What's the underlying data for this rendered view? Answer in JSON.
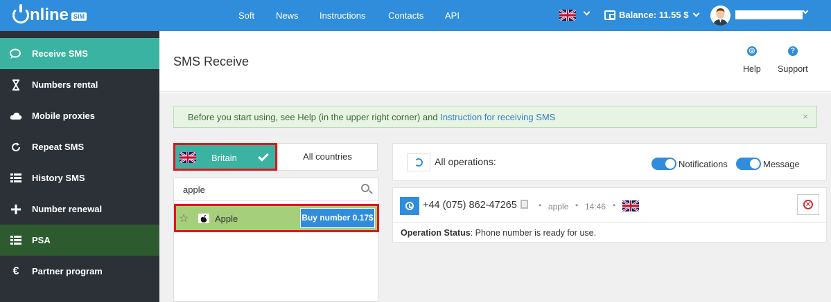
{
  "topbar": {
    "logo_text": "nline",
    "logo_badge": "SIM",
    "nav": [
      {
        "label": "Soft"
      },
      {
        "label": "News"
      },
      {
        "label": "Instructions"
      },
      {
        "label": "Contacts"
      },
      {
        "label": "API"
      }
    ],
    "balance": "Balance: 11.55 $"
  },
  "sidebar": {
    "items": [
      {
        "label": "Receive SMS",
        "icon": "chat-icon"
      },
      {
        "label": "Numbers rental",
        "icon": "hourglass-icon"
      },
      {
        "label": "Mobile proxies",
        "icon": "cloud-icon"
      },
      {
        "label": "Repeat SMS",
        "icon": "repeat-icon"
      },
      {
        "label": "History SMS",
        "icon": "list-icon"
      },
      {
        "label": "Number renewal",
        "icon": "plus-icon"
      },
      {
        "label": "PSA",
        "icon": "list-icon"
      },
      {
        "label": "Partner program",
        "icon": "euro-icon"
      }
    ]
  },
  "header": {
    "title": "SMS Receive",
    "help_label": "Help",
    "support_label": "Support"
  },
  "alert": {
    "text": "Before you start using, see Help (in the upper right corner) and ",
    "link": "Instruction for receiving SMS",
    "close": "×"
  },
  "countries": {
    "selected": "Britain",
    "all": "All countries"
  },
  "search": {
    "value": "apple"
  },
  "service": {
    "name": "Apple",
    "buy_label": "Buy number 0.17$"
  },
  "operations": {
    "label": "All operations:",
    "notifications_label": "Notifications",
    "message_label": "Message",
    "items": [
      {
        "phone": "+44 (075) 862-47265",
        "service": "apple",
        "time": "14:46",
        "status_label": "Operation Status",
        "status_text": ": Phone number is ready for use."
      }
    ]
  },
  "colors": {
    "topbar": "#2f8ddc",
    "sidebar": "#2b3137",
    "sidebar_active": "#3bb3a2",
    "psa": "#2e5a30",
    "highlight": "#e0151b",
    "service_row": "#a5cf7a"
  }
}
